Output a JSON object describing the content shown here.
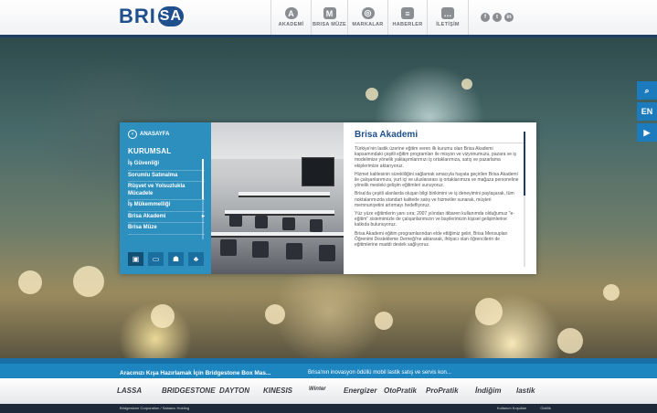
{
  "header": {
    "logo_text": "BRI",
    "logo_badge": "SA",
    "nav": [
      {
        "label": "AKADEMİ",
        "icon": "akademi-icon",
        "glyph": "A"
      },
      {
        "label": "BRISA MÜZE",
        "icon": "muze-icon",
        "glyph": "M"
      },
      {
        "label": "MARKALAR",
        "icon": "tire-icon",
        "glyph": "◎"
      },
      {
        "label": "HABERLER",
        "icon": "news-icon",
        "glyph": "≡"
      },
      {
        "label": "İLETİŞİM",
        "icon": "chat-icon",
        "glyph": "…"
      }
    ],
    "social": [
      {
        "icon": "facebook-icon",
        "glyph": "f"
      },
      {
        "icon": "twitter-icon",
        "glyph": "t"
      },
      {
        "icon": "linkedin-icon",
        "glyph": "in"
      }
    ]
  },
  "side_tools": {
    "search_glyph": "⌕",
    "lang": "EN",
    "youtube_glyph": "▶"
  },
  "menu": {
    "home_label": "ANASAYFA",
    "title": "KURUMSAL",
    "items": [
      {
        "label": "İş Güvenliği"
      },
      {
        "label": "Sorumlu Satınalma"
      },
      {
        "label": "Rüşvet ve Yolsuzlukla Mücadele"
      },
      {
        "label": "İş Mükemmelliği"
      },
      {
        "label": "Brisa Akademi",
        "arrow": "▸"
      },
      {
        "label": "Brisa Müze"
      }
    ],
    "icon_buttons": [
      {
        "icon": "briefcase-icon",
        "glyph": "▣"
      },
      {
        "icon": "presentation-icon",
        "glyph": "▭"
      },
      {
        "icon": "people-icon",
        "glyph": "☗"
      },
      {
        "icon": "tree-icon",
        "glyph": "♣"
      }
    ]
  },
  "article": {
    "title": "Brisa Akademi",
    "paragraphs": [
      "Türkiye'nin lastik üzerine eğitim veren ilk kurumu olan Brisa Akademi kapsamındaki çeşitli eğitim programları ile misyon ve vizyonumuzu, pazara ve iş modelimize yönelik yaklaşımlarımızı iş ortaklarımıza, satış ve pazarlama ekiplerimize aktarıyoruz.",
      "Hizmet kalitesinin sürekliliğini sağlamak amacıyla hayata geçirilen Brisa Akademi ile çalışanlarımıza, yurt içi ve uluslararası iş ortaklarımıza ve mağaza personeline yönelik mesleki gelişim eğitimleri sunuyoruz.",
      "Brisa'da çeşitli alanlarda oluşan bilgi birikimini ve iş deneyimini paylaşarak, tüm noktalarımızda standart kalitede satış ve hizmetler sunarak, müşteri memnuniyetini artırmayı hedefliyoruz.",
      "Yüz yüze eğitimlerin yanı sıra; 2007 yılından itibaren kullanımda olduğumuz \"e-eğitim\" sistemimizle de çalışanlarımızın ve bayilerimizin kişisel gelişimlerine katkıda bulunuyoruz.",
      "Brisa Akademi eğitim programlarından elde ettiğimiz geliri, Brisa Mensupları Öğrenimi Destekleme Derneği'ne aktararak, ihtiyacı olan öğrencilerin de eğitimlerine maddi destek sağlıyoruz."
    ]
  },
  "news": {
    "item1": "Aracınızı Kışa Hazırlamak İçin Bridgestone Box Mas...",
    "item2": "Brisa'nın inovasyon ödüllü mobil lastik satış ve servis kon..."
  },
  "brands": [
    "LASSA",
    "BRIDGESTONE",
    "DAYTON",
    "KINESIS",
    "Winter",
    "Energizer",
    "OtoPratik",
    "ProPratik",
    "İndiğim",
    "lastik"
  ],
  "footer": {
    "left": "Bridgestone Corporation / Sabancı Holding",
    "right1": "Kullanım Koşulları",
    "right2": "Gizlilik"
  }
}
